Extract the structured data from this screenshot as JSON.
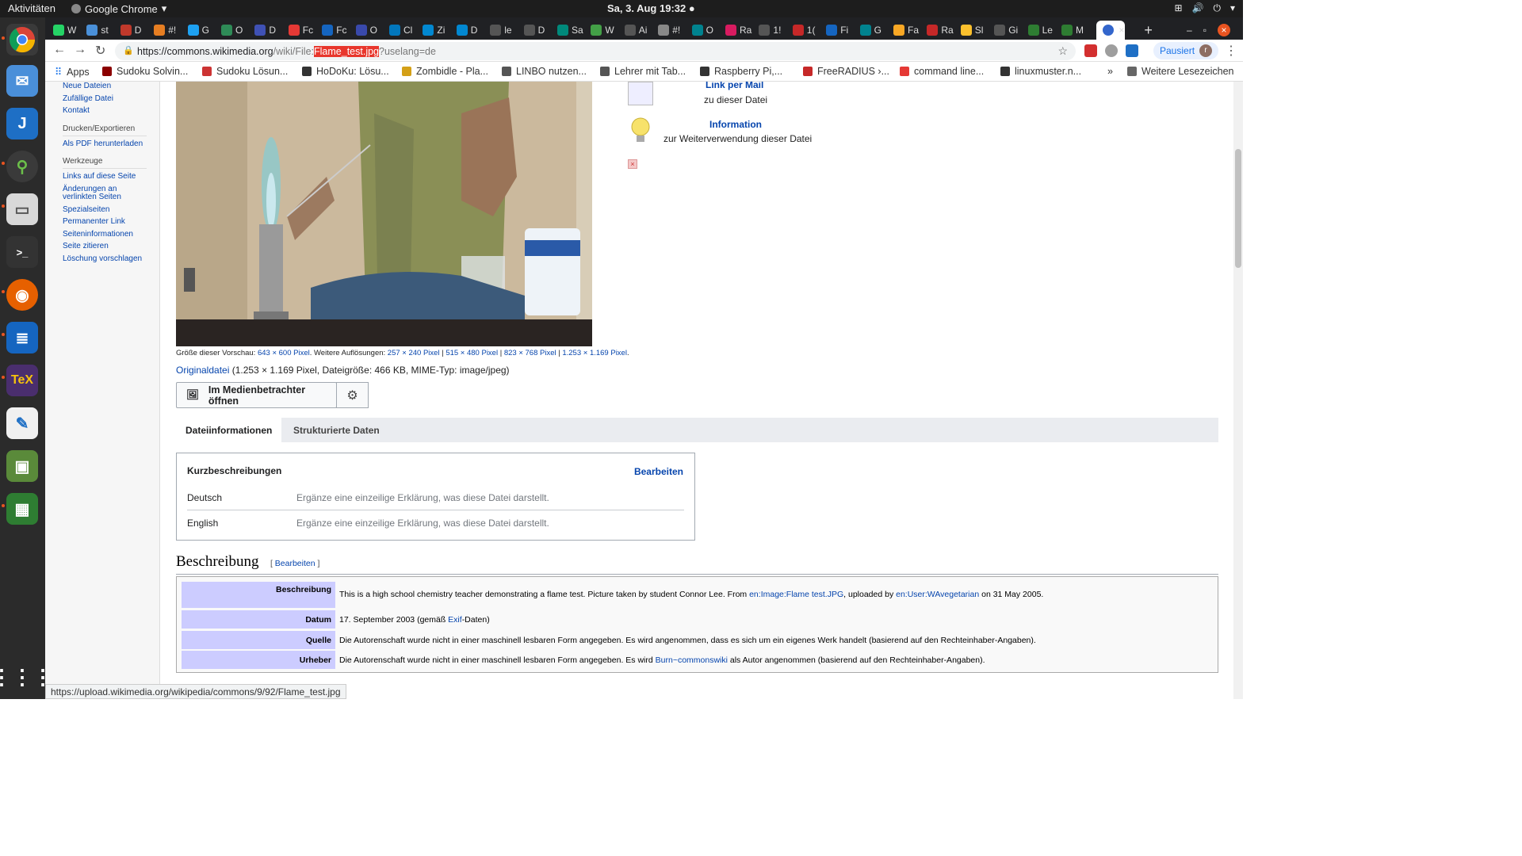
{
  "gnome": {
    "activities": "Aktivitäten",
    "app_name": "Google Chrome",
    "clock": "Sa, 3. Aug  19:32"
  },
  "tabs": [
    {
      "label": "W",
      "color": "#25d366"
    },
    {
      "label": "st",
      "color": "#4a90d9"
    },
    {
      "label": "D",
      "color": "#c0392b"
    },
    {
      "label": "#!",
      "color": "#e67e22"
    },
    {
      "label": "G",
      "color": "#1da1f2"
    },
    {
      "label": "O",
      "color": "#2e8b57"
    },
    {
      "label": "D",
      "color": "#3f51b5"
    },
    {
      "label": "Fc",
      "color": "#e53935"
    },
    {
      "label": "Fc",
      "color": "#1565c0"
    },
    {
      "label": "O",
      "color": "#3949ab"
    },
    {
      "label": "Cl",
      "color": "#0277bd"
    },
    {
      "label": "Zi",
      "color": "#0288d1"
    },
    {
      "label": "D",
      "color": "#0288d1"
    },
    {
      "label": "le",
      "color": "#555555"
    },
    {
      "label": "D",
      "color": "#555555"
    },
    {
      "label": "Sa",
      "color": "#00897b"
    },
    {
      "label": "W",
      "color": "#43a047"
    },
    {
      "label": "Ai",
      "color": "#555555"
    },
    {
      "label": "#!",
      "color": "#888888"
    },
    {
      "label": "O",
      "color": "#00838f"
    },
    {
      "label": "Ra",
      "color": "#d81b60"
    },
    {
      "label": "1!",
      "color": "#555555"
    },
    {
      "label": "1(",
      "color": "#c62828"
    },
    {
      "label": "Fi",
      "color": "#1565c0"
    },
    {
      "label": "G",
      "color": "#00838f"
    },
    {
      "label": "Fa",
      "color": "#f9a825"
    },
    {
      "label": "Ra",
      "color": "#c62828"
    },
    {
      "label": "Sl",
      "color": "#fbc02d"
    },
    {
      "label": "Gi",
      "color": "#555555"
    },
    {
      "label": "Le",
      "color": "#2e7d32"
    },
    {
      "label": "M",
      "color": "#2e7d32"
    }
  ],
  "address": {
    "prefix": "https://",
    "host": "commons.wikimedia.org",
    "path": "/wiki/File:",
    "highlight": "Flame_test.jpg",
    "query": "?uselang=de"
  },
  "profile_button": "Pausiert",
  "profile_initial": "r",
  "bookmarks": {
    "apps": "Apps",
    "items": [
      "Sudoku Solvin...",
      "Sudoku Lösun...",
      "HoDoKu: Lösu...",
      "Zombidle - Pla...",
      "LINBO nutzen...",
      "Lehrer mit Tab...",
      "Raspberry Pi,...",
      "FreeRADIUS ›...",
      "command line...",
      "linuxmuster.n..."
    ],
    "more": "»",
    "others": "Weitere Lesezeichen"
  },
  "sidebar": {
    "top_links": [
      "Neue Dateien",
      "Zufällige Datei",
      "Kontakt"
    ],
    "print_heading": "Drucken/Exportieren",
    "print_links": [
      "Als PDF herunterladen"
    ],
    "tools_heading": "Werkzeuge",
    "tools_links": [
      "Links auf diese Seite",
      "Änderungen an verlinkten Seiten",
      "Spezialseiten",
      "Permanenter Link",
      "Seiteninformationen",
      "Seite zitieren",
      "Löschung vorschlagen"
    ]
  },
  "file": {
    "preview_label": "Größe dieser Vorschau:",
    "preview_size": "643 × 600 Pixel",
    "more_res_label": ". Weitere Auflösungen:",
    "res1": "257 × 240 Pixel",
    "res2": "515 × 480 Pixel",
    "res3": "823 × 768 Pixel",
    "res4": "1.253 × 1.169 Pixel",
    "res_end": ".",
    "orig_link": "Originaldatei",
    "orig_info": " (1.253 × 1.169 Pixel, Dateigröße: 466 KB, MIME-Typ: image/jpeg)",
    "viewer_button": "Im Medienbetrachter öffnen"
  },
  "right_panel": {
    "mail_link": "Link per Mail",
    "mail_sub": "zu dieser Datei",
    "info_link": "Information",
    "info_sub": "zur Weiterverwendung dieser Datei"
  },
  "content_tabs": {
    "tab1": "Dateiinformationen",
    "tab2": "Strukturierte Daten"
  },
  "captions": {
    "heading": "Kurzbeschreibungen",
    "edit": "Bearbeiten",
    "rows": [
      {
        "lang": "Deutsch",
        "placeholder": "Ergänze eine einzeilige Erklärung, was diese Datei darstellt."
      },
      {
        "lang": "English",
        "placeholder": "Ergänze eine einzeilige Erklärung, was diese Datei darstellt."
      }
    ]
  },
  "description": {
    "heading": "Beschreibung",
    "edit_open": "[ ",
    "edit": "Bearbeiten",
    "edit_close": " ]",
    "row_desc_key": "Beschreibung",
    "row_desc_text1": "This is a high school chemistry teacher demonstrating a flame test. Picture taken by student Connor Lee. From ",
    "row_desc_link1": "en:Image:Flame test.JPG",
    "row_desc_text2": ", uploaded by ",
    "row_desc_link2": "en:User:WAvegetarian",
    "row_desc_text3": " on 31 May 2005.",
    "row_date_key": "Datum",
    "row_date_text1": "17. September 2003 (gemäß ",
    "row_date_link": "Exif",
    "row_date_text2": "-Daten)",
    "row_source_key": "Quelle",
    "row_source_text": "Die Autorenschaft wurde nicht in einer maschinell lesbaren Form angegeben. Es wird angenommen, dass es sich um ein eigenes Werk handelt (basierend auf den Rechteinhaber-Angaben).",
    "row_author_key": "Urheber",
    "row_author_text1": "Die Autorenschaft wurde nicht in einer maschinell lesbaren Form angegeben. Es wird ",
    "row_author_link": "Burn~commonswiki",
    "row_author_text2": " als Autor angenommen (basierend auf den Rechteinhaber-Angaben)."
  },
  "status_url": "https://upload.wikimedia.org/wikipedia/commons/9/92/Flame_test.jpg"
}
